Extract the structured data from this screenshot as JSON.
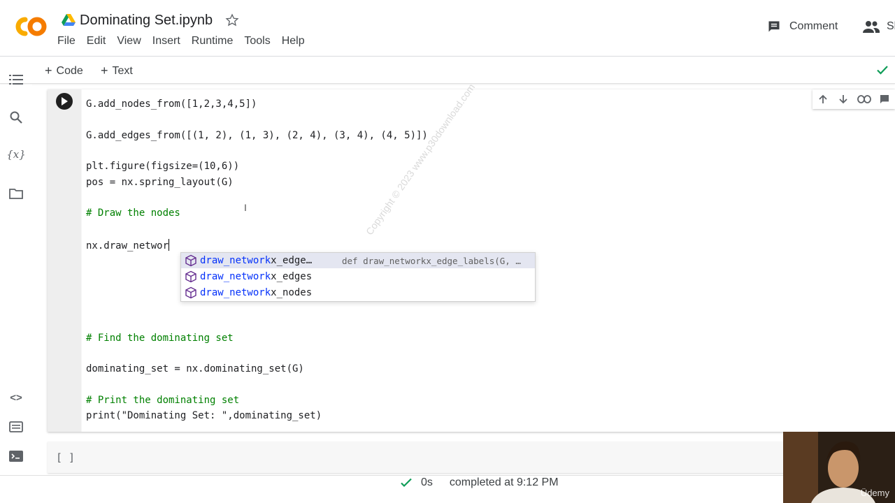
{
  "app": {
    "title": "Dominating Set.ipynb"
  },
  "menu": [
    "File",
    "Edit",
    "View",
    "Insert",
    "Runtime",
    "Tools",
    "Help"
  ],
  "header_actions": {
    "comment": "Comment",
    "share": "Sh"
  },
  "toolbar": {
    "add_code": "Code",
    "add_text": "Text"
  },
  "code_lines": {
    "l1": "G.add_nodes_from([1,2,3,4,5])",
    "l2": "G.add_edges_from([(1, 2), (1, 3), (2, 4), (3, 4), (4, 5)])",
    "l3": "plt.figure(figsize=(10,6))",
    "l4": "pos = nx.spring_layout(G)",
    "l5": "# Draw the nodes",
    "l6": "nx.draw_networ",
    "l7": "# Find the dominating set",
    "l8": "dominating_set = nx.dominating_set(G)",
    "l9": "# Print the dominating set",
    "l10": "print(\"Dominating Set: \",dominating_set)"
  },
  "autocomplete": {
    "items": [
      {
        "label": "draw_networkx_edge…",
        "match": "draw_network",
        "rest": "x_edge…",
        "detail": "def draw_networkx_edge_labels(G, …"
      },
      {
        "label": "draw_networkx_edges",
        "match": "draw_network",
        "rest": "x_edges"
      },
      {
        "label": "draw_networkx_nodes",
        "match": "draw_network",
        "rest": "x_nodes"
      }
    ]
  },
  "watermark": "Copyright © 2023 www.p30download.com",
  "next_cell_prompt": "[ ]",
  "status": {
    "duration": "0s",
    "completed": "completed at 9:12 PM"
  },
  "webcam_brand": "Üdemy",
  "colors": {
    "accent_orange": "#f9ab00",
    "check_green": "#0f9d58",
    "keyword_blue": "#0431fa",
    "comment_green": "#008000"
  }
}
